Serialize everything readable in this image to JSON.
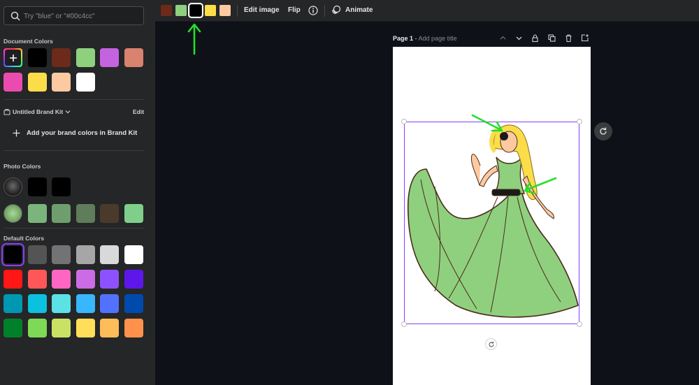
{
  "search": {
    "placeholder": "Try \"blue\" or \"#00c4cc\""
  },
  "document_colors": {
    "title": "Document Colors",
    "add_icon": "plus-icon",
    "swatches": [
      "#000000",
      "#6b2a1a",
      "#8fd07e",
      "#c463e0",
      "#d9826f",
      "#e94cae",
      "#fbdd4a",
      "#fcc9a0",
      "#ffffff"
    ]
  },
  "brand_kit": {
    "name": "Untitled Brand Kit",
    "edit_label": "Edit",
    "add_label": "Add your brand colors in Brand Kit"
  },
  "photo_colors": {
    "title": "Photo Colors",
    "row1": [
      "#000000",
      "#000000"
    ],
    "row2": [
      "#7bb57c",
      "#6f9e6e",
      "#5f7c5b",
      "#4a3a2c",
      "#7fcf8a"
    ]
  },
  "default_colors": {
    "title": "Default Colors",
    "swatches": [
      "#000000",
      "#545454",
      "#737373",
      "#a6a6a6",
      "#d9d9d9",
      "#ffffff",
      "#ff1616",
      "#ff5757",
      "#ff66c4",
      "#cb6ce6",
      "#8c52ff",
      "#5e17eb",
      "#0097b2",
      "#0cc0df",
      "#5ce1e6",
      "#38b6ff",
      "#5271ff",
      "#004aad",
      "#00802b",
      "#7ed957",
      "#c9e265",
      "#ffde59",
      "#ffbd59",
      "#ff914d"
    ]
  },
  "toolbar": {
    "swatches": [
      "#6b2a1a",
      "#8fd07e",
      "#000000",
      "#fbdd4a",
      "#fcc9a0"
    ],
    "selected_index": 2,
    "edit_image": "Edit image",
    "flip": "Flip",
    "animate": "Animate"
  },
  "page": {
    "label": "Page 1",
    "separator": " - ",
    "title_placeholder": "Add page title"
  },
  "colors": {
    "accent": "#8b3dff",
    "arrow": "#22e02b"
  }
}
